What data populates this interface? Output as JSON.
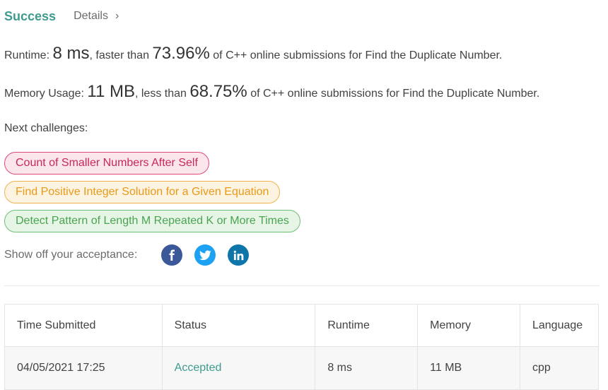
{
  "header": {
    "status": "Success",
    "details_label": "Details",
    "details_chevron": "›"
  },
  "runtime": {
    "label": "Runtime: ",
    "value": "8 ms",
    "comparison": ", faster than ",
    "percent": "73.96%",
    "suffix": " of C++ online submissions for Find the Duplicate Number."
  },
  "memory": {
    "label": "Memory Usage: ",
    "value": "11 MB",
    "comparison": ", less than ",
    "percent": "68.75%",
    "suffix": " of C++ online submissions for Find the Duplicate Number."
  },
  "next_challenges": {
    "label": "Next challenges:",
    "items": [
      {
        "title": "Count of Smaller Numbers After Self",
        "difficulty": "hard",
        "color": "#c8285a"
      },
      {
        "title": "Find Positive Integer Solution for a Given Equation",
        "difficulty": "medium",
        "color": "#e89a1a"
      },
      {
        "title": "Detect Pattern of Length M Repeated K or More Times",
        "difficulty": "easy",
        "color": "#4aa452"
      }
    ]
  },
  "share": {
    "label": "Show off your acceptance:",
    "icons": [
      "facebook-icon",
      "twitter-icon",
      "linkedin-icon"
    ]
  },
  "table": {
    "headers": [
      "Time Submitted",
      "Status",
      "Runtime",
      "Memory",
      "Language"
    ],
    "rows": [
      {
        "time": "04/05/2021 17:25",
        "status": "Accepted",
        "runtime": "8 ms",
        "memory": "11 MB",
        "language": "cpp"
      }
    ]
  },
  "colors": {
    "accent": "#3f9b8f",
    "facebook": "#3b5998",
    "twitter": "#1da1f2",
    "linkedin": "#0e76a8"
  }
}
